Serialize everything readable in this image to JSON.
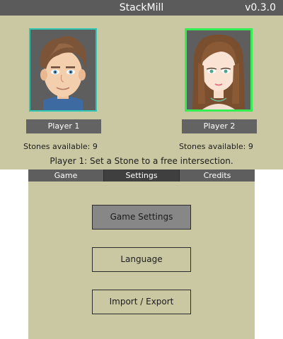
{
  "app": {
    "title": "StackMill",
    "version": "v0.3.0"
  },
  "players": [
    {
      "name": "Player 1",
      "stones_text": "Stones available: 9",
      "avatar": "male-avatar",
      "frame_color": "#2ec7b4"
    },
    {
      "name": "Player 2",
      "stones_text": "Stones available: 9",
      "avatar": "female-avatar",
      "frame_color": "#34ee52"
    }
  ],
  "status": "Player 1: Set a Stone to a free intersection.",
  "tabs": [
    {
      "label": "Game",
      "active": false
    },
    {
      "label": "Settings",
      "active": true
    },
    {
      "label": "Credits",
      "active": false
    }
  ],
  "menu": {
    "items": [
      {
        "label": "Game Settings",
        "selected": true
      },
      {
        "label": "Language",
        "selected": false
      },
      {
        "label": "Import / Export",
        "selected": false
      }
    ]
  },
  "colors": {
    "background": "#cac8a2",
    "title_bar": "#5b5b5b",
    "label_bg": "#636363",
    "selected_button": "#878787"
  }
}
